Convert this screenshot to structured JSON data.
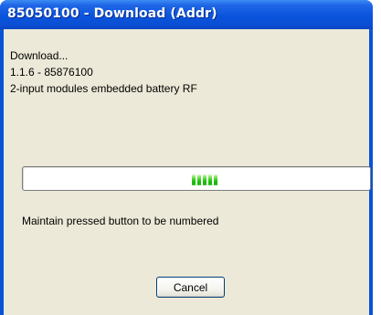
{
  "window": {
    "title": "85050100 - Download (Addr)"
  },
  "info": {
    "line1": "Download...",
    "line2": "1.1.6 - 85876100",
    "line3": "2-input modules embedded battery RF"
  },
  "progress": {
    "chunk_count": 5,
    "position_fraction": 0.5
  },
  "status": {
    "text": "Maintain pressed button to be numbered"
  },
  "buttons": {
    "cancel_label": "Cancel"
  },
  "colors": {
    "titlebar": "#0a54dd",
    "client": "#ece9d8",
    "progress_chunk": "#2ac61a"
  }
}
